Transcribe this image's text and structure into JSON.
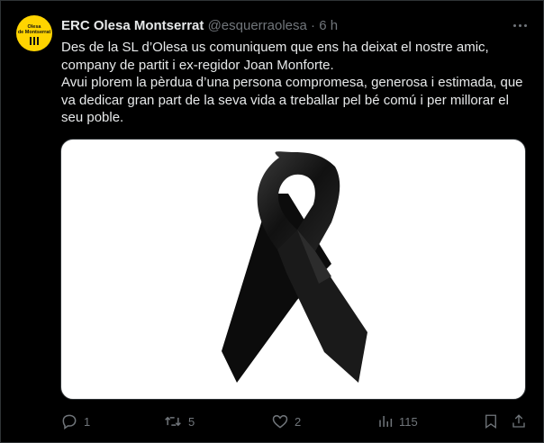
{
  "tweet": {
    "author_name": "ERC Olesa Montserrat",
    "handle": "@esquerraolesa",
    "separator": "·",
    "time": "6 h",
    "avatar": {
      "line1": "Olesa",
      "line2": "de Montserrat",
      "color": "#ffd400"
    },
    "paragraph1": "Des de la SL d’Olesa us comuniquem que ens ha deixat el nostre amic, company de partit i ex-regidor Joan Monforte.",
    "paragraph2": "Avui plorem la pèrdua d’una persona compromesa, generosa i estimada, que va dedicar gran part de la seva vida a treballar pel bé comú i per millorar el seu poble.",
    "media_icon": "black-mourning-ribbon"
  },
  "actions": {
    "replies": "1",
    "retweets": "5",
    "likes": "2",
    "views": "115"
  },
  "colors": {
    "background": "#000000",
    "text": "#e7e9ea",
    "muted": "#71767b",
    "border": "#2f3336"
  }
}
